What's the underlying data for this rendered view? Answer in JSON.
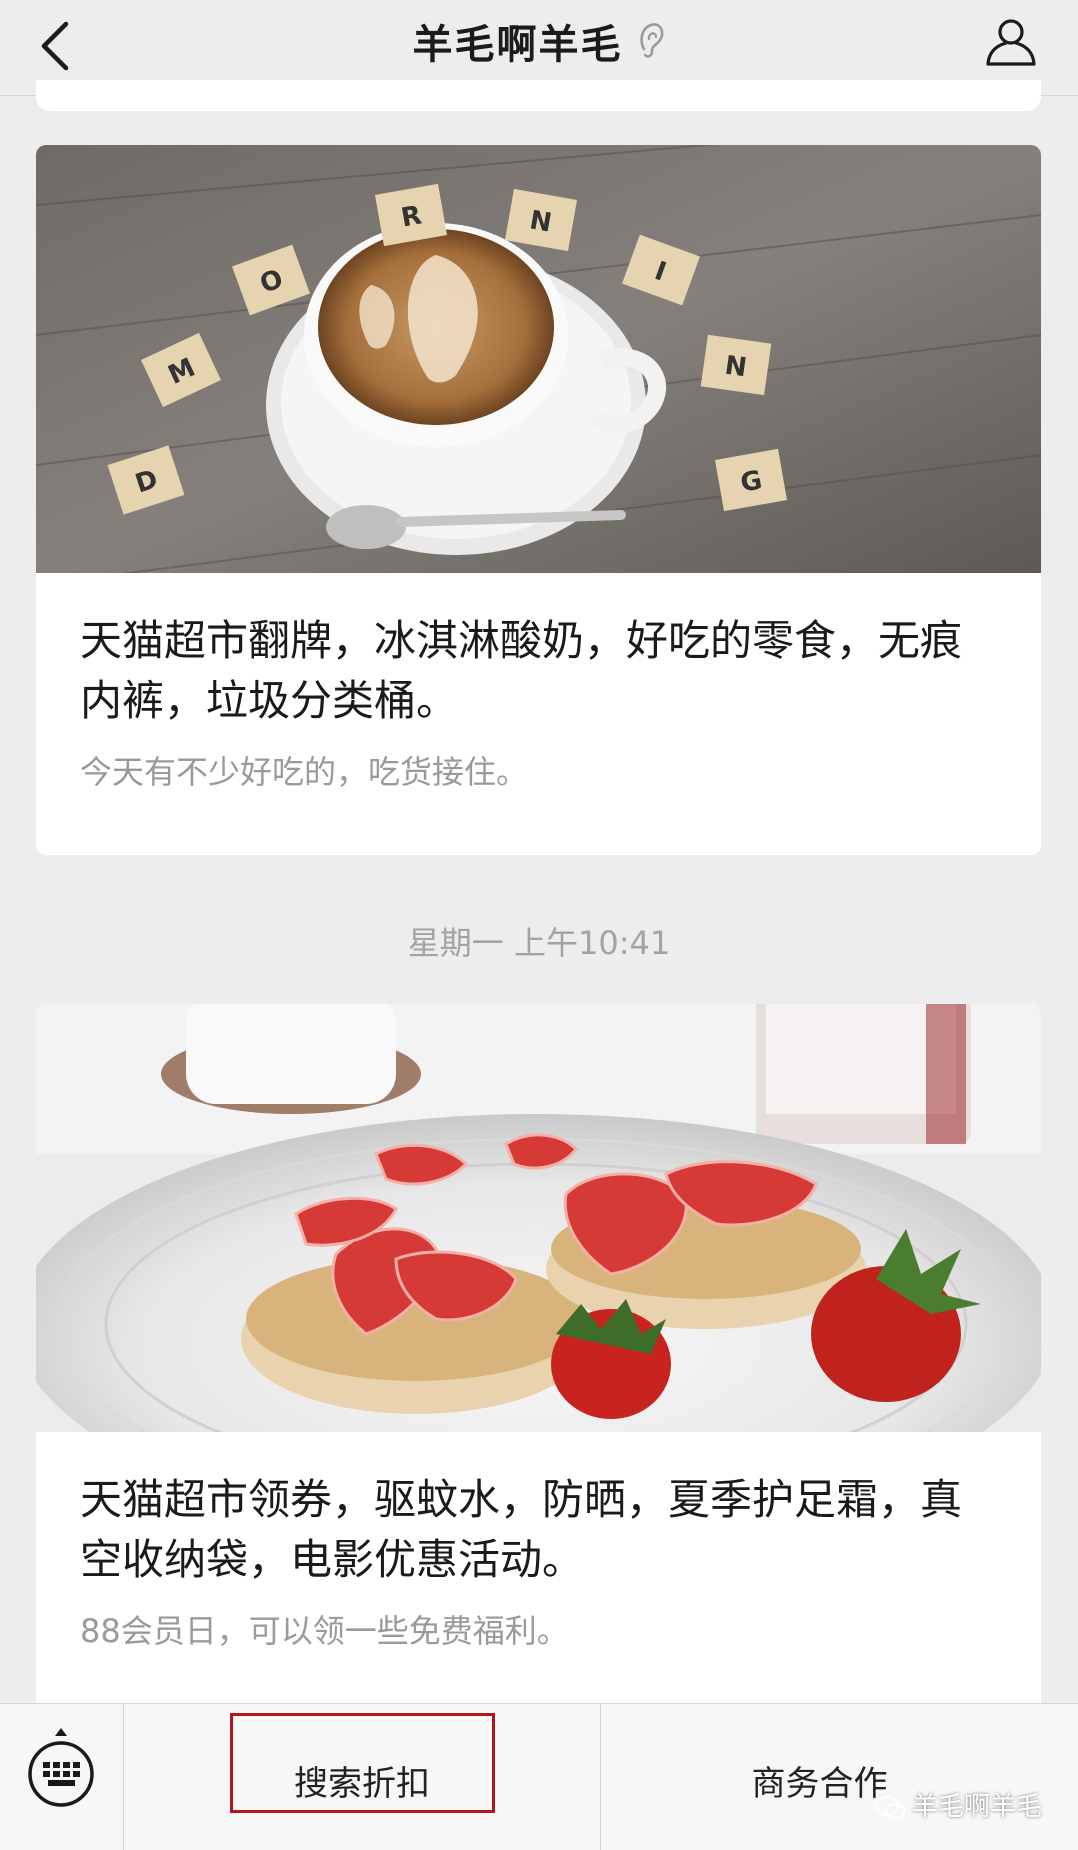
{
  "header": {
    "title": "羊毛啊羊毛"
  },
  "cards": [
    {
      "title": "天猫超市翻牌，冰淇淋酸奶，好吃的零食，无痕内裤，垃圾分类桶。",
      "subtitle": "今天有不少好吃的，吃货接住。",
      "image": "coffee-morning-photo"
    },
    {
      "title": "天猫超市领券，驱蚊水，防晒，夏季护足霜，真空收纳袋，电影优惠活动。",
      "subtitle": "88会员日，可以领一些免费福利。",
      "image": "strawberry-muffin-photo"
    }
  ],
  "timestamp": "星期一 上午10:41",
  "bottom_menu": {
    "item1": "搜索折扣",
    "item2": "商务合作"
  },
  "watermark": "羊毛啊羊毛",
  "colors": {
    "background": "#ededed",
    "card": "#ffffff",
    "highlight_border": "#b0161c"
  }
}
